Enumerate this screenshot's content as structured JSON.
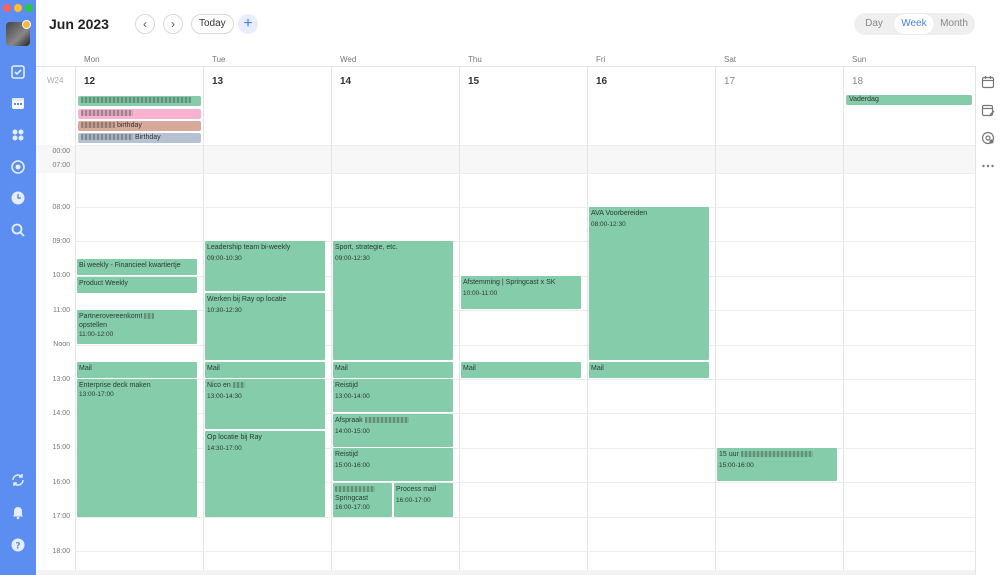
{
  "header": {
    "month_title": "Jun 2023",
    "prev_label": "‹",
    "next_label": "›",
    "today_label": "Today",
    "add_label": "+",
    "views": [
      "Day",
      "Week",
      "Month"
    ],
    "selected_view": "Week"
  },
  "week_label": "W24",
  "days": [
    {
      "name": "Mon",
      "num": "12"
    },
    {
      "name": "Tue",
      "num": "13"
    },
    {
      "name": "Wed",
      "num": "14"
    },
    {
      "name": "Thu",
      "num": "15"
    },
    {
      "name": "Fri",
      "num": "16"
    },
    {
      "name": "Sat",
      "num": "17"
    },
    {
      "name": "Sun",
      "num": "18"
    }
  ],
  "time_labels": [
    "00:00",
    "07:00",
    "08:00",
    "09:00",
    "10:00",
    "11:00",
    "Noon",
    "13:00",
    "14:00",
    "15:00",
    "16:00",
    "17:00",
    "18:00"
  ],
  "all_day": {
    "mon_1": {
      "title": "",
      "color": "#84ccaa"
    },
    "mon_2": {
      "title": "",
      "color": "#f7b3cf"
    },
    "mon_3": {
      "title": "birthday",
      "color": "#d6a99a"
    },
    "mon_4": {
      "title": "Birthday",
      "color": "#b5c2d4"
    },
    "sun_1": {
      "title": "Vaderdag",
      "color": "#84ccaa"
    }
  },
  "events": {
    "mon_biweekly": {
      "title": "Bi weekly - Financieel kwartiertje",
      "time": ""
    },
    "mon_product": {
      "title": "Product Weekly",
      "time": ""
    },
    "mon_partner": {
      "title": "Partnerovereenkomt",
      "title2": "opstellen",
      "time": "11:00-12:00"
    },
    "mon_mail": {
      "title": "Mail",
      "time": ""
    },
    "mon_enterprise": {
      "title": "Enterprise deck maken",
      "time": "13:00-17:00"
    },
    "tue_leadership": {
      "title": "Leadership team bi-weekly",
      "time": "09:00-10:30"
    },
    "tue_werken": {
      "title": "Werken bij Ray op locatie",
      "time": "10:30-12:30"
    },
    "tue_mail": {
      "title": "Mail",
      "time": ""
    },
    "tue_nico": {
      "title": "Nico en",
      "time": "13:00-14:30"
    },
    "tue_oplocatie": {
      "title": "Op locatie bij Ray",
      "time": "14:30-17:00"
    },
    "wed_sport": {
      "title": "Sport, strategie, etc.",
      "time": "09:00-12:30"
    },
    "wed_mail": {
      "title": "Mail",
      "time": ""
    },
    "wed_reistijd1": {
      "title": "Reistijd",
      "time": "13:00-14:00"
    },
    "wed_afspraak": {
      "title": "Afspraak",
      "time": "14:00-15:00"
    },
    "wed_reistijd2": {
      "title": "Reistijd",
      "time": "15:00-16:00"
    },
    "wed_springcast": {
      "title": "Springcast",
      "time": "16:00-17:00"
    },
    "wed_process": {
      "title": "Process mail",
      "time": "16:00-17:00"
    },
    "thu_afstemming": {
      "title": "Afstemming | Springcast x SK",
      "time": "10:00-11:00"
    },
    "thu_mail": {
      "title": "Mail",
      "time": ""
    },
    "fri_ava": {
      "title": "AVA Voorbereiden",
      "time": "08:00-12:30"
    },
    "fri_mail": {
      "title": "Mail",
      "time": ""
    },
    "sat_15uur": {
      "title": "15 uur",
      "time": "15:00-16:00"
    }
  },
  "colors": {
    "sidebar": "#5b8ef0",
    "event": "#84ccaa",
    "accent": "#4a7df0"
  },
  "icons": {
    "sidebar": [
      "checkbox-icon",
      "calendar-icon",
      "grid-icon",
      "target-icon",
      "clock-icon",
      "search-icon",
      "sync-icon",
      "bell-icon",
      "help-icon"
    ],
    "right": [
      "calendar-view-icon",
      "calendar-edit-icon",
      "settings-icon",
      "more-icon"
    ]
  }
}
